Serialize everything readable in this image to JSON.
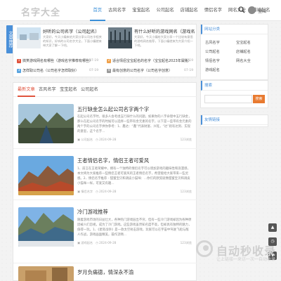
{
  "header": {
    "logo": "名字大全",
    "nav": [
      "首页",
      "古风名字",
      "宝宝起名",
      "公司起名",
      "店铺起名",
      "情侣名字",
      "网名大全",
      "游戏起名"
    ],
    "user_name": "登陆"
  },
  "side_badge": "文章推荐",
  "featured": {
    "items": [
      {
        "title": "好听的公司名字（公司起名）",
        "desc": "大家好，今天小编来给大家分享公司名字相关的知识，好听的公司名字大全，下面小编就来带大家了解一下吧。"
      },
      {
        "title": "有什么好听的游戏网名（游戏名）",
        "desc": "大家好，今天小编给大家分享一个比较有意思的游戏网名推荐，下面小编就来为大家介绍一下吧。"
      }
    ],
    "list": [
      {
        "num": "1",
        "title": "搞笑游戏网名有哪些（游戏名字推荐有哪些）",
        "date": "07-19"
      },
      {
        "num": "2",
        "title": "适合情侣宝宝起名的名字（宝宝起名2023年属兔）",
        "date": "07-19"
      },
      {
        "num": "3",
        "title": "怎样取公司名（公司名字怎样取好）",
        "date": "07-19"
      },
      {
        "num": "4",
        "title": "最有创意的公司名字（公司名字创意）",
        "date": "07-19"
      }
    ]
  },
  "tabs": [
    "最新文章",
    "古风名字",
    "宝宝起名",
    "公司起名"
  ],
  "articles": [
    {
      "title": "五行缺金怎么起公司名字两个字",
      "summary": "在起公司名字时，很多人会考虑五行缺什么的问题，如果你的八字命理中五行缺金，那么在起公司名字的时候可以选择一些带有金元素的名字，以下是一些带有金元素的两个字的公司名字供你参考：1、鑫达：“鑫”代表财富、兴旺，“达”则有达到、实现的意思，这个名字...",
      "category": "公司起名",
      "date": "2024-09-28",
      "views": "123浏览"
    },
    {
      "title": "王者情侣名字，情侣王者可爱风",
      "summary": "1、前言在王者荣耀中，拥有一个独特的情侣名字可以增加游戏的趣味性和浪漫感，本文将为大家推荐一些情侣王者可爱风的王者情侣名字，希望能给大家带来一些灵感。2、情侣名字推荐 - 甜蜜宝贝和调皮小猫咪：...你们的默契就像甜蜜宝贝和调皮小猫咪一样，可爱又有趣...",
      "category": "情侣名字",
      "date": "2024-09-28",
      "views": "123浏览"
    },
    {
      "title": "冷门游戏推荐",
      "summary": "随着游戏市场的日益壮大，各种热门游戏层出不穷，但有一些冷门游戏却因为各种原因被人们忽视，成为了冷门游戏。这些游戏虽然知名度不高，但却具有独特的魅力，值得一玩。1、《星际战争》是一款太空射击游戏，玩家可以在宇宙中驾驶飞船与敌人作战，游戏画面精美，操作流畅...",
      "category": "游戏起名",
      "date": "2024-09-28",
      "views": "123浏览"
    },
    {
      "title": "岁月负痛德，情深永不渝",
      "summary": "",
      "category": "",
      "date": "",
      "views": ""
    }
  ],
  "sidebar": {
    "categories_title": "网站分类",
    "categories": [
      "古风名字",
      "宝宝起名",
      "公司起名",
      "店铺起名",
      "情侣名字",
      "网名大全",
      "游戏起名"
    ],
    "search_title": "搜索",
    "search_placeholder": "",
    "search_button": "搜索",
    "links_title": "友情链接"
  },
  "float_buttons": [
    "▲",
    "◷",
    "▼"
  ],
  "watermark": {
    "text": "自动秒收录",
    "sub": "让上链接一来访一次一自动收录"
  },
  "colors": {
    "accent": "#3a8fd8",
    "tab_active": "#e0533c",
    "num1": "#e0533c",
    "num2": "#f0a14a",
    "num3": "#5aa5e0",
    "num4": "#9a9a9a"
  }
}
